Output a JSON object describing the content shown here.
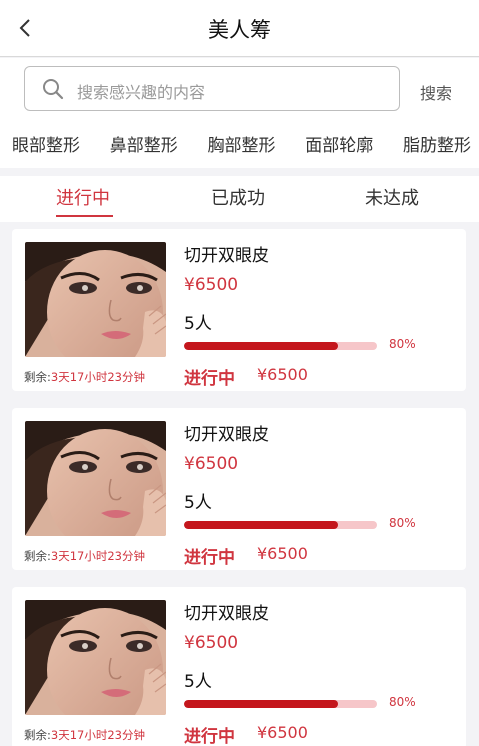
{
  "header": {
    "title": "美人筹",
    "back_icon": "chevron-left-icon"
  },
  "search": {
    "placeholder": "搜索感兴趣的内容",
    "button_label": "搜索",
    "icon": "search-icon"
  },
  "categories": [
    "眼部整形",
    "鼻部整形",
    "胸部整形",
    "面部轮廓",
    "脂肪整形"
  ],
  "tabs": [
    {
      "label": "进行中",
      "active": true
    },
    {
      "label": "已成功",
      "active": false
    },
    {
      "label": "未达成",
      "active": false
    }
  ],
  "colors": {
    "accent": "#d0353f",
    "progress_fill": "#c4161c",
    "progress_track": "#f6c6c9"
  },
  "items": [
    {
      "name": "切开双眼皮",
      "price": "¥6500",
      "people": "5人",
      "progress": 0.8,
      "progress_label": "80%",
      "remaining_label": "剩余:",
      "remaining_time": "3天17小时23分钟",
      "status": "进行中",
      "status_price": "¥6500"
    },
    {
      "name": "切开双眼皮",
      "price": "¥6500",
      "people": "5人",
      "progress": 0.8,
      "progress_label": "80%",
      "remaining_label": "剩余:",
      "remaining_time": "3天17小时23分钟",
      "status": "进行中",
      "status_price": "¥6500"
    },
    {
      "name": "切开双眼皮",
      "price": "¥6500",
      "people": "5人",
      "progress": 0.8,
      "progress_label": "80%",
      "remaining_label": "剩余:",
      "remaining_time": "3天17小时23分钟",
      "status": "进行中",
      "status_price": "¥6500"
    }
  ]
}
